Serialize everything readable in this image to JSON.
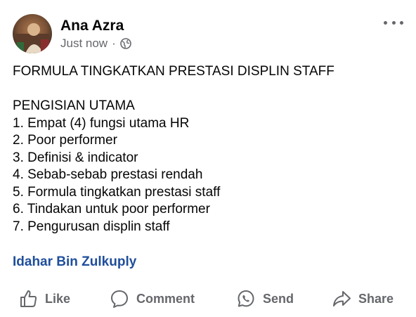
{
  "post": {
    "author": "Ana Azra",
    "time": "Just now",
    "separator": "·",
    "privacy_icon": "globe-icon",
    "more_icon": "more-options-icon"
  },
  "content": {
    "title": "FORMULA TINGKATKAN PRESTASI DISPLIN STAFF",
    "section": "PENGISIAN UTAMA",
    "items": [
      "1. Empat (4) fungsi utama HR",
      "2. Poor performer",
      "3. Definisi & indicator",
      "4. Sebab-sebab prestasi rendah",
      "5. Formula tingkatkan prestasi staff",
      "6. Tindakan untuk poor performer",
      "7. Pengurusan displin staff"
    ],
    "mention": "Idahar Bin Zulkuply"
  },
  "actions": {
    "like": "Like",
    "comment": "Comment",
    "send": "Send",
    "share": "Share"
  },
  "colors": {
    "text": "#050505",
    "secondary": "#65676b",
    "link": "#1f4e9c",
    "background": "#ffffff"
  }
}
